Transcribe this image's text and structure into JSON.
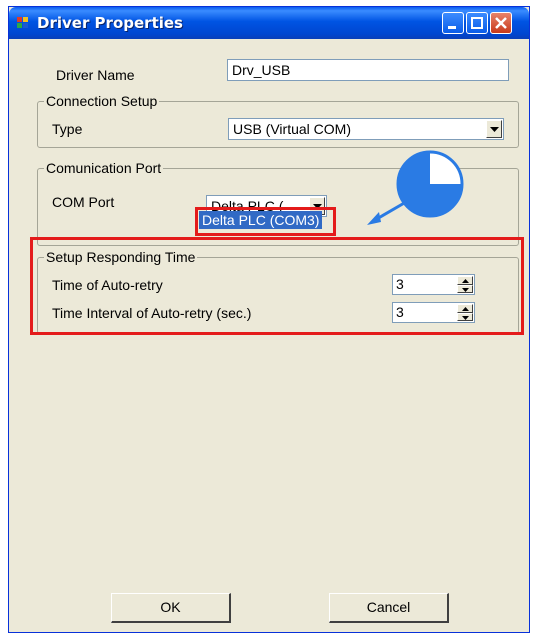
{
  "window": {
    "title": "Driver Properties",
    "icons": [
      "app-icon",
      "minimize-icon",
      "maximize-icon",
      "close-icon"
    ]
  },
  "driver_name": {
    "label": "Driver Name",
    "value": "Drv_USB"
  },
  "connection_setup": {
    "legend": "Connection Setup",
    "type_label": "Type",
    "type_value": "USB (Virtual COM)"
  },
  "communication_port": {
    "legend": "Comunication Port",
    "com_port_label": "COM Port",
    "com_port_value": "Delta PLC (",
    "dropdown_option": "Delta PLC (COM3)"
  },
  "responding_time": {
    "legend": "Setup Responding Time",
    "auto_retry_label": "Time of Auto-retry",
    "auto_retry_value": "3",
    "interval_label": "Time Interval of Auto-retry (sec.)",
    "interval_value": "3"
  },
  "buttons": {
    "ok": "OK",
    "cancel": "Cancel"
  },
  "colors": {
    "highlight": "#e41b1b",
    "pointer": "#2a7be4",
    "selection": "#316ac5",
    "titlebar": "#0054e3"
  }
}
